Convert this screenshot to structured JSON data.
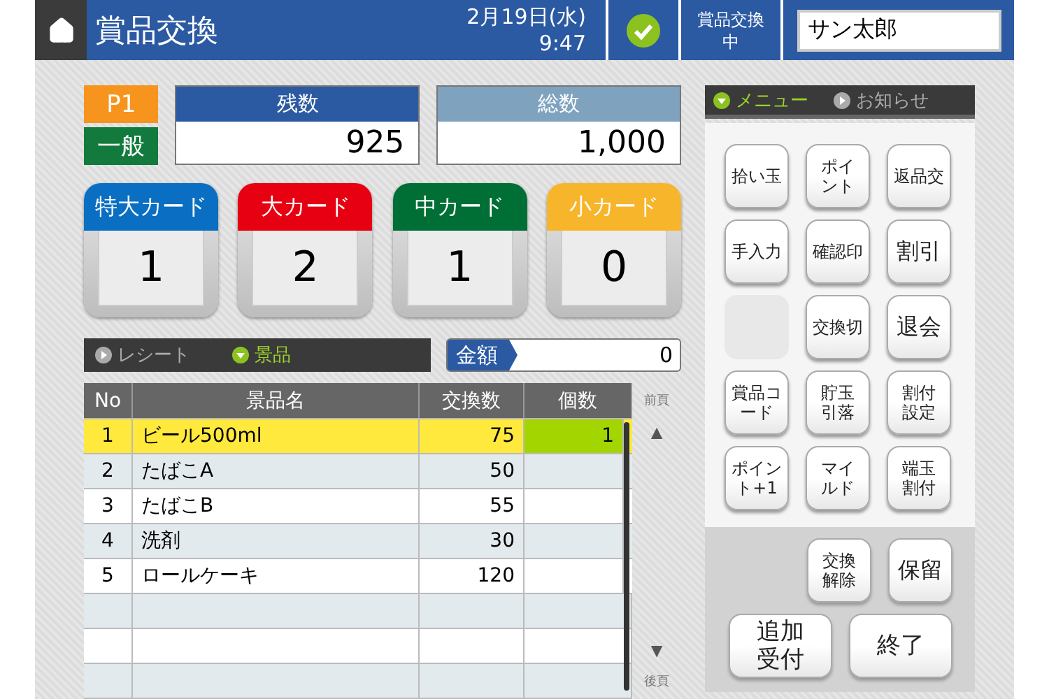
{
  "header": {
    "title": "賞品交換",
    "date": "2月19日(水)",
    "time": "9:47",
    "status_ok": true,
    "status": "賞品交換中",
    "operator": "サン太郎"
  },
  "member": {
    "player": "P1",
    "rank": "一般"
  },
  "counters": [
    {
      "label": "残数",
      "value": "925",
      "kind": "primary"
    },
    {
      "label": "総数",
      "value": "1,000",
      "kind": "secondary"
    }
  ],
  "cards": [
    {
      "label": "特大カード",
      "value": "1",
      "color": "#0a6fc2"
    },
    {
      "label": "大カード",
      "value": "2",
      "color": "#e60012"
    },
    {
      "label": "中カード",
      "value": "1",
      "color": "#006f35"
    },
    {
      "label": "小カード",
      "value": "0",
      "color": "#f7b52c"
    }
  ],
  "list_tabs": [
    {
      "label": "レシート",
      "selected": false
    },
    {
      "label": "景品",
      "selected": true
    }
  ],
  "amount": {
    "label": "金額",
    "value": "0"
  },
  "table": {
    "columns": [
      "No",
      "景品名",
      "交換数",
      "個数"
    ],
    "rows": [
      {
        "no": "1",
        "name": "ビール500ml",
        "points": "75",
        "qty": "1",
        "selected": true
      },
      {
        "no": "2",
        "name": "たばこA",
        "points": "50",
        "selected": false
      },
      {
        "no": "3",
        "name": "たばこB",
        "points": "55",
        "selected": false
      },
      {
        "no": "4",
        "name": "洗剤",
        "points": "30",
        "selected": false
      },
      {
        "no": "5",
        "name": "ロールケーキ",
        "points": "120",
        "selected": false
      }
    ]
  },
  "pager": {
    "prev": "前頁",
    "up": "▲",
    "down": "▼",
    "next": "後頁"
  },
  "menu_tabs": [
    {
      "label": "メニュー",
      "selected": true
    },
    {
      "label": "お知らせ",
      "selected": false
    }
  ],
  "menu_buttons": [
    {
      "kind": "button",
      "label": "拾い玉",
      "wrapped": false
    },
    {
      "kind": "button",
      "label": "ポイント",
      "wrapped": true
    },
    {
      "kind": "button",
      "label": "返品交",
      "wrapped": false
    },
    {
      "kind": "button",
      "label": "手入力",
      "wrapped": false
    },
    {
      "kind": "button",
      "label": "確認印",
      "wrapped": false
    },
    {
      "kind": "large",
      "label": "割引",
      "wrapped": false
    },
    {
      "kind": "blank"
    },
    {
      "kind": "button",
      "label": "交換切",
      "wrapped": false
    },
    {
      "kind": "large",
      "label": "退会",
      "wrapped": false
    },
    {
      "kind": "button",
      "label": "賞品コード",
      "wrapped": true
    },
    {
      "kind": "button",
      "label": "貯玉引落",
      "wrapped": true
    },
    {
      "kind": "button",
      "label": "割付設定",
      "wrapped": true
    },
    {
      "kind": "button",
      "label": "ポイント+1",
      "wrapped": true
    },
    {
      "kind": "button",
      "label": "マイルド",
      "wrapped": true
    },
    {
      "kind": "button",
      "label": "端玉割付",
      "wrapped": true
    }
  ],
  "action_buttons": [
    {
      "label": "交換解除",
      "kind": "button",
      "wrapped": true
    },
    {
      "label": "保留",
      "kind": "large",
      "wrapped": false
    },
    {
      "label": "追加受付",
      "kind": "wide",
      "wrapped": true
    },
    {
      "label": "終了",
      "kind": "wide",
      "wrapped": false
    }
  ]
}
